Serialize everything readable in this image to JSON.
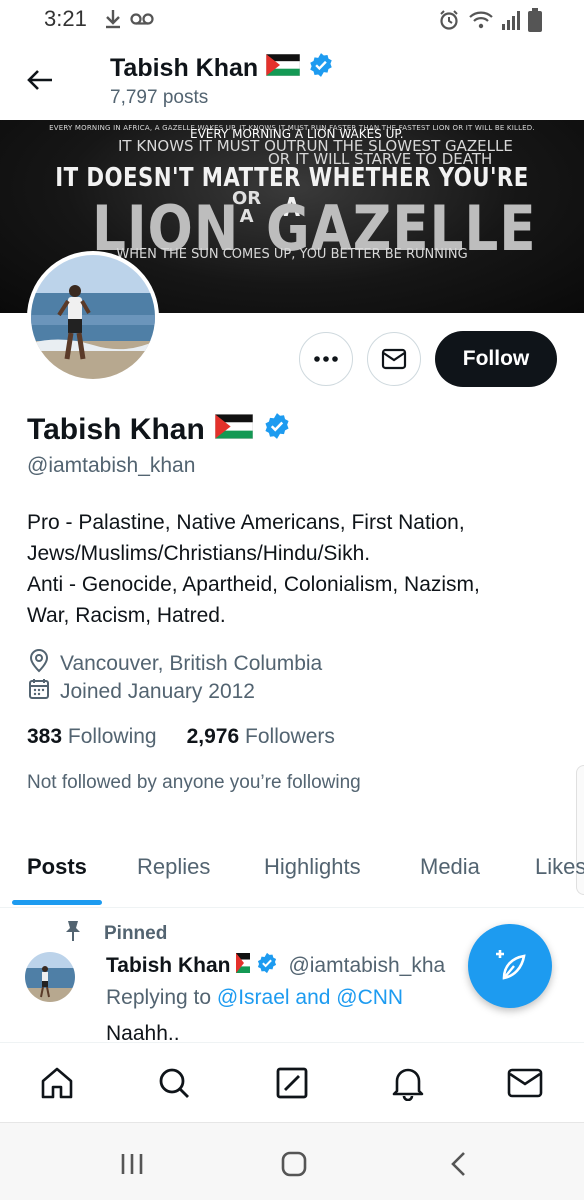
{
  "status_bar": {
    "time": "3:21",
    "icons_left": [
      "download-icon",
      "voicemail-icon"
    ],
    "icons_right": [
      "alarm-icon",
      "wifi-icon",
      "signal-icon",
      "battery-icon"
    ]
  },
  "header": {
    "name": "Tabish Khan",
    "posts_count": "7,797 posts"
  },
  "banner": {
    "line1": "EVERY MORNING IN AFRICA, A GAZELLE WAKES UP. IT KNOWS IT MUST RUN FASTER THAN THE FASTEST LION OR IT WILL BE KILLED.",
    "line2": "EVERY MORNING A LION WAKES UP.",
    "line3": "IT KNOWS IT MUST OUTRUN THE SLOWEST GAZELLE",
    "line4": "OR IT WILL STARVE TO DEATH",
    "line5": "IT DOESN'T MATTER WHETHER YOU'RE A",
    "word_lion": "LION",
    "word_or": "OR",
    "word_a": "A",
    "word_gazelle": "GAZELLE",
    "line_bottom": "WHEN THE SUN COMES UP, YOU BETTER BE RUNNING"
  },
  "actions": {
    "more_icon": "more-icon",
    "message_icon": "envelope-icon",
    "follow_label": "Follow"
  },
  "profile": {
    "name": "Tabish Khan",
    "handle": "@iamtabish_khan",
    "bio_lines": [
      "Pro - Palastine, Native Americans, First Nation,",
      "Jews/Muslims/Christians/Hindu/Sikh.",
      "Anti - Genocide, Apartheid, Colonialism, Nazism,",
      "War, Racism, Hatred."
    ],
    "location": "Vancouver, British Columbia",
    "joined": "Joined January 2012",
    "following_count": "383",
    "following_label": "Following",
    "followers_count": "2,976",
    "followers_label": "Followers",
    "not_followed": "Not followed by anyone you’re following"
  },
  "tabs": [
    "Posts",
    "Replies",
    "Highlights",
    "Media",
    "Likes"
  ],
  "active_tab": "Posts",
  "pinned_post": {
    "pinned_label": "Pinned",
    "author_name": "Tabish Khan",
    "author_handle": "@iamtabish_kha",
    "reply_prefix": "Replying to",
    "reply_mentions": "@Israel and @CNN",
    "text": "Naahh.."
  },
  "bottom_nav": [
    "home-icon",
    "search-icon",
    "grok-icon",
    "notifications-icon",
    "messages-icon"
  ],
  "colors": {
    "accent": "#1d9bf0",
    "text_primary": "#0f1419",
    "text_secondary": "#536471",
    "follow_button": "#0f1419",
    "verified": "#1d9bf0"
  }
}
